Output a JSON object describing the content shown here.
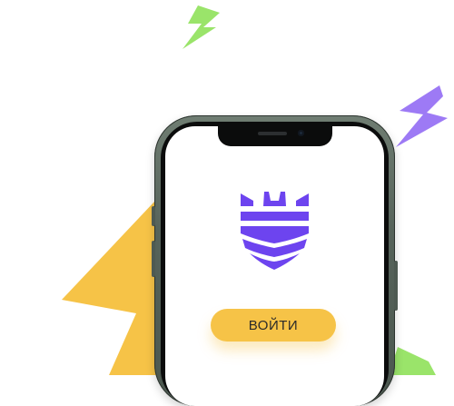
{
  "login_button": {
    "label": "ВОЙТИ"
  },
  "colors": {
    "accent_yellow": "#f6c347",
    "accent_green": "#9ae46a",
    "accent_purple": "#9d7af5",
    "logo_purple": "#6d44ef"
  },
  "icons": {
    "logo": "shield-castle-icon",
    "decorations": [
      "lightning-bolt-icon",
      "lightning-bolt-icon",
      "lightning-bolt-icon"
    ]
  }
}
